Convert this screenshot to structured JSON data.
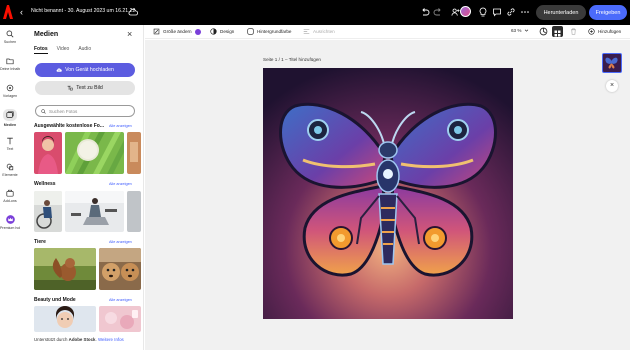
{
  "topbar": {
    "back_icon": "chevron-left-icon",
    "doc_title": "Nicht benannt - 30. August 2023 um 16.21.22",
    "download_label": "Herunterladen",
    "share_label": "Freigeben",
    "accent": "#4b6bfb"
  },
  "rail": {
    "items": [
      {
        "label": "Suchen",
        "icon": "search-icon"
      },
      {
        "label": "Deine Inhalte",
        "icon": "folder-icon"
      },
      {
        "label": "Vorlagen",
        "icon": "templates-icon"
      },
      {
        "label": "Medien",
        "icon": "media-icon"
      },
      {
        "label": "Text",
        "icon": "text-icon"
      },
      {
        "label": "Elemente",
        "icon": "shapes-icon"
      },
      {
        "label": "Add-ons",
        "icon": "addons-icon"
      },
      {
        "label": "Premium holen",
        "icon": "crown-icon"
      }
    ]
  },
  "panel": {
    "title": "Medien",
    "tabs": [
      "Fotos",
      "Video",
      "Audio"
    ],
    "upload_label": "Von Gerät hochladen",
    "text_to_image_label": "Text zu Bild",
    "search_placeholder": "Suchen Fotos",
    "sections": [
      {
        "title": "Ausgewählte kostenlose Fo...",
        "link": "Alle anzeigen"
      },
      {
        "title": "Wellness",
        "link": "Alle anzeigen"
      },
      {
        "title": "Tiere",
        "link": "Alle anzeigen"
      },
      {
        "title": "Beauty und Mode",
        "link": "Alle anzeigen"
      }
    ],
    "footer_prefix": "Unterstützt durch ",
    "footer_brand": "Adobe Stock",
    "footer_link": "Weitere Infos"
  },
  "toolbar": {
    "change_size": "Größe ändern",
    "design": "Design",
    "background_color": "Hintergrundfarbe",
    "align": "Ausrichten",
    "zoom": "63 %",
    "add": "Hinzufügen"
  },
  "canvas": {
    "page_label": "Seite 1 / 1 – Titel hinzufügen"
  }
}
